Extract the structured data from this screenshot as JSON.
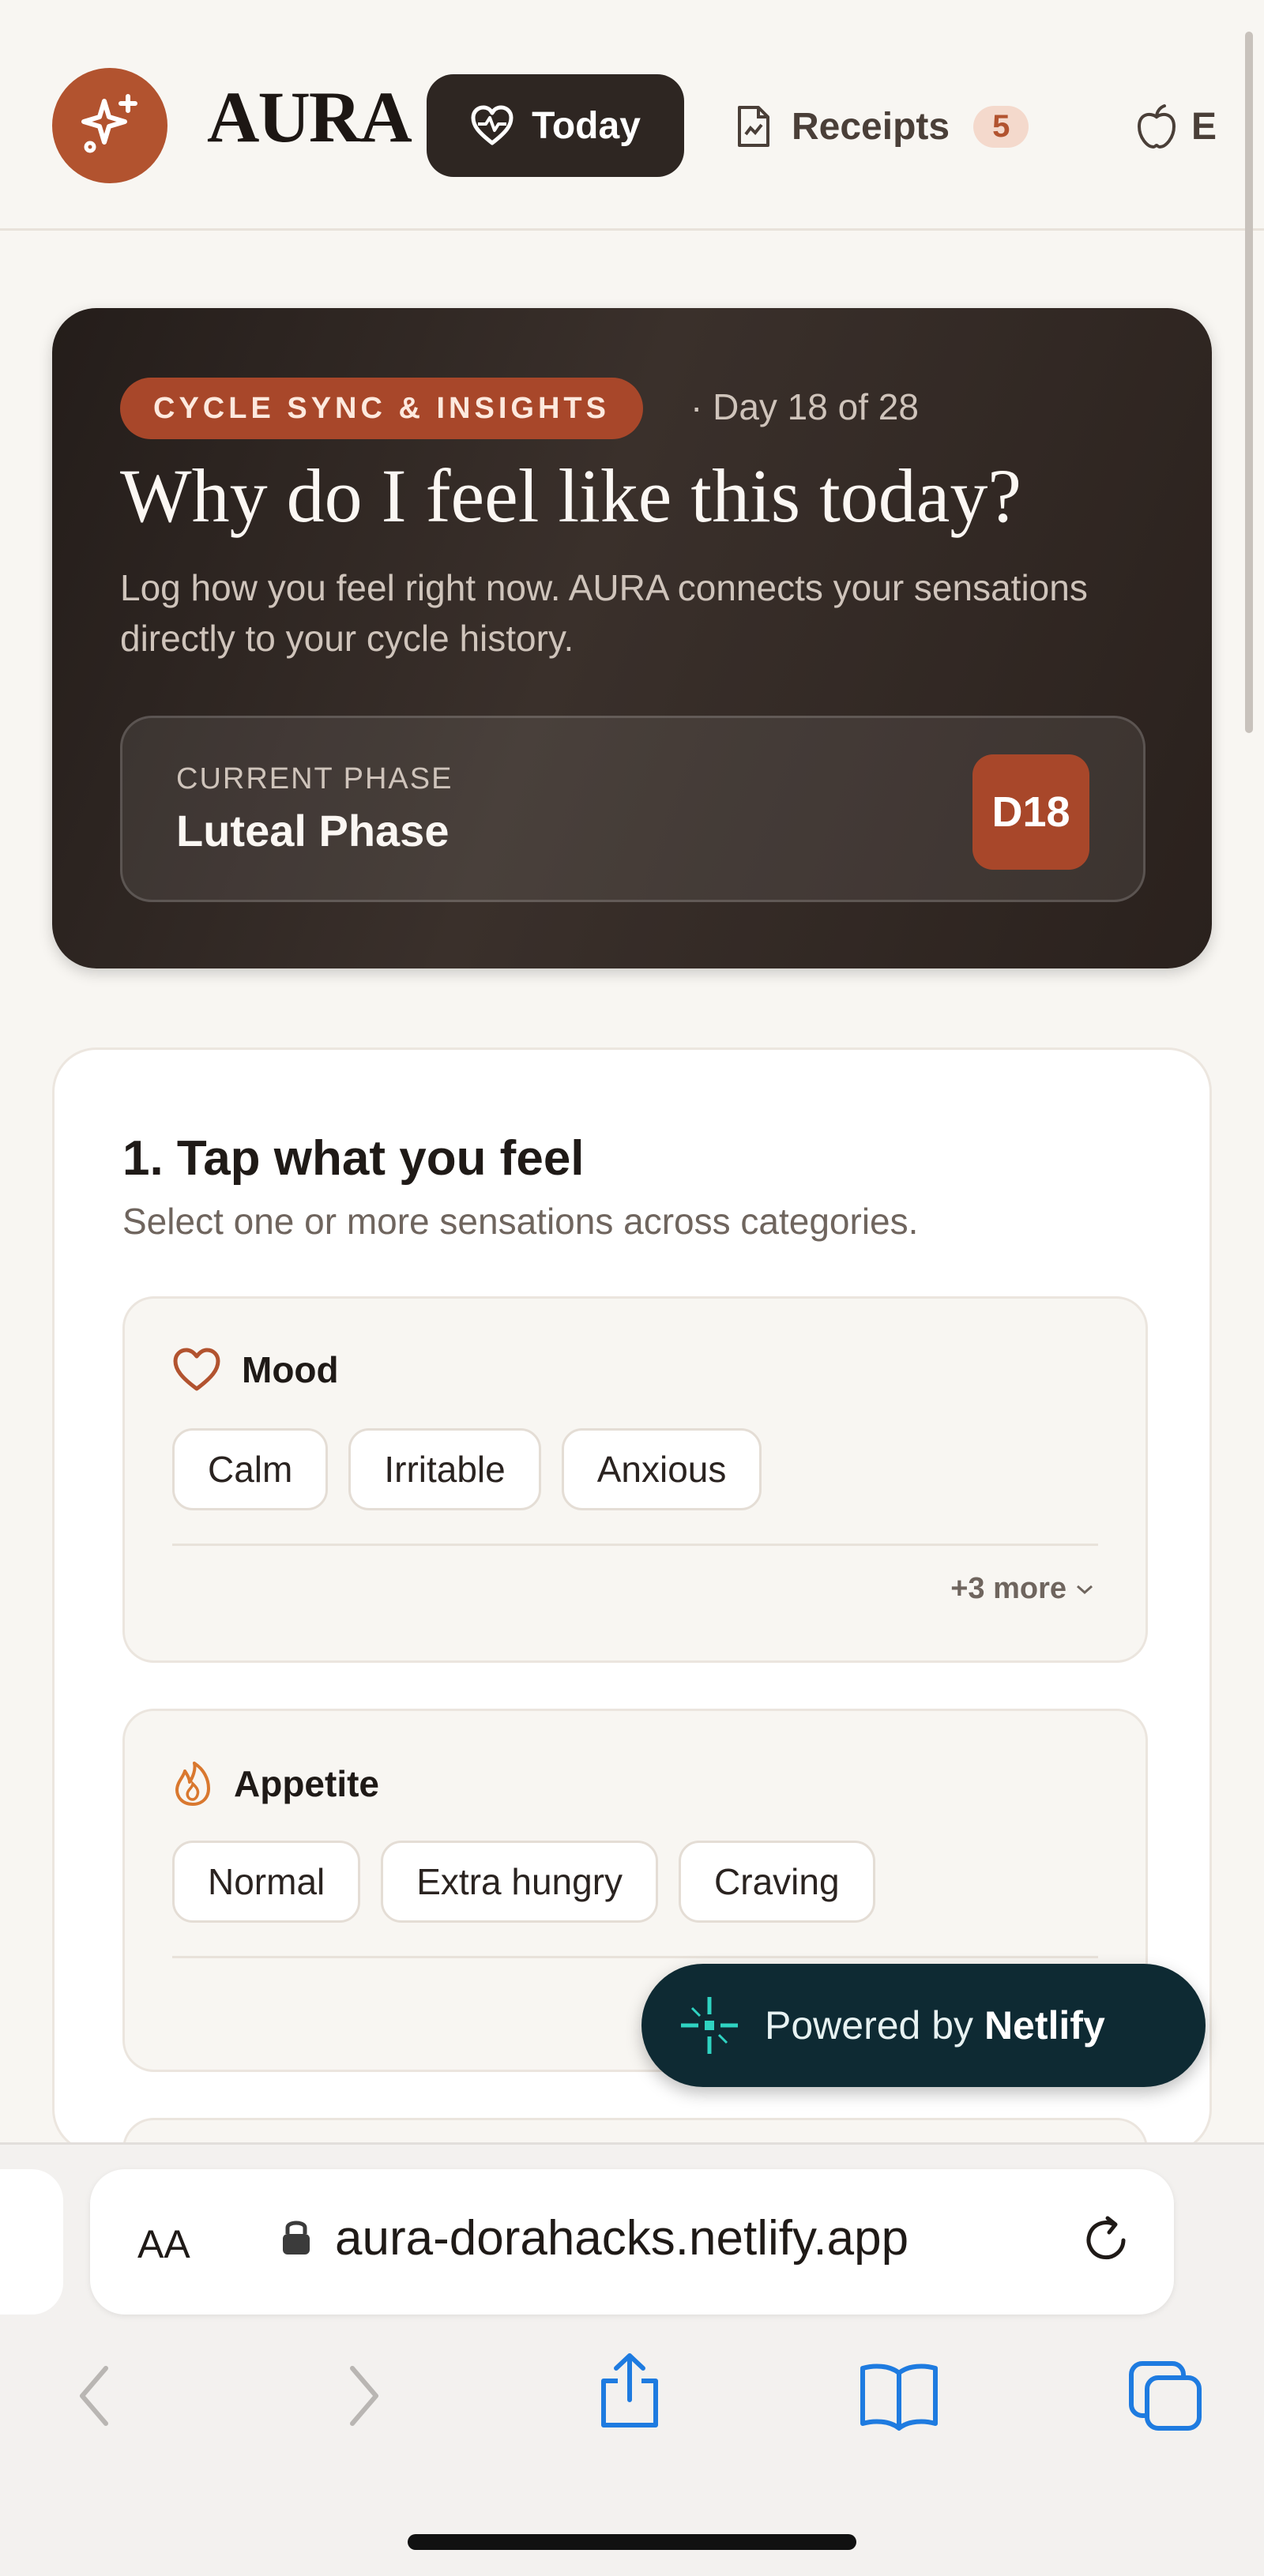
{
  "header": {
    "brand": "AURA",
    "nav": {
      "today_label": "Today",
      "receipts_label": "Receipts",
      "receipts_count": "5",
      "more_label": "E"
    }
  },
  "hero": {
    "pill": "CYCLE SYNC & INSIGHTS",
    "day": "· Day 18 of 28",
    "title": "Why do I feel like this today?",
    "subtitle": "Log how you feel right now. AURA connects your sensations directly to your cycle history.",
    "phase_label": "CURRENT PHASE",
    "phase_name": "Luteal Phase",
    "phase_day": "D18"
  },
  "feel": {
    "title": "1. Tap what you feel",
    "subtitle": "Select one or more sensations across categories.",
    "categories": [
      {
        "name": "Mood",
        "icon": "heart-icon",
        "chips": [
          "Calm",
          "Irritable",
          "Anxious"
        ],
        "more": "+3 more"
      },
      {
        "name": "Appetite",
        "icon": "flame-icon",
        "chips": [
          "Normal",
          "Extra hungry",
          "Craving"
        ]
      }
    ]
  },
  "netlify": {
    "prefix": "Powered by",
    "brand": "Netlify"
  },
  "browser": {
    "aa": "AA",
    "url": "aura-dorahacks.netlify.app"
  },
  "colors": {
    "accent": "#b2532f",
    "hero_bg": "#2e2622",
    "netlify_bg": "#0e2a33",
    "netlify_accent": "#2fd3c2",
    "browser_blue": "#1e7be0"
  }
}
